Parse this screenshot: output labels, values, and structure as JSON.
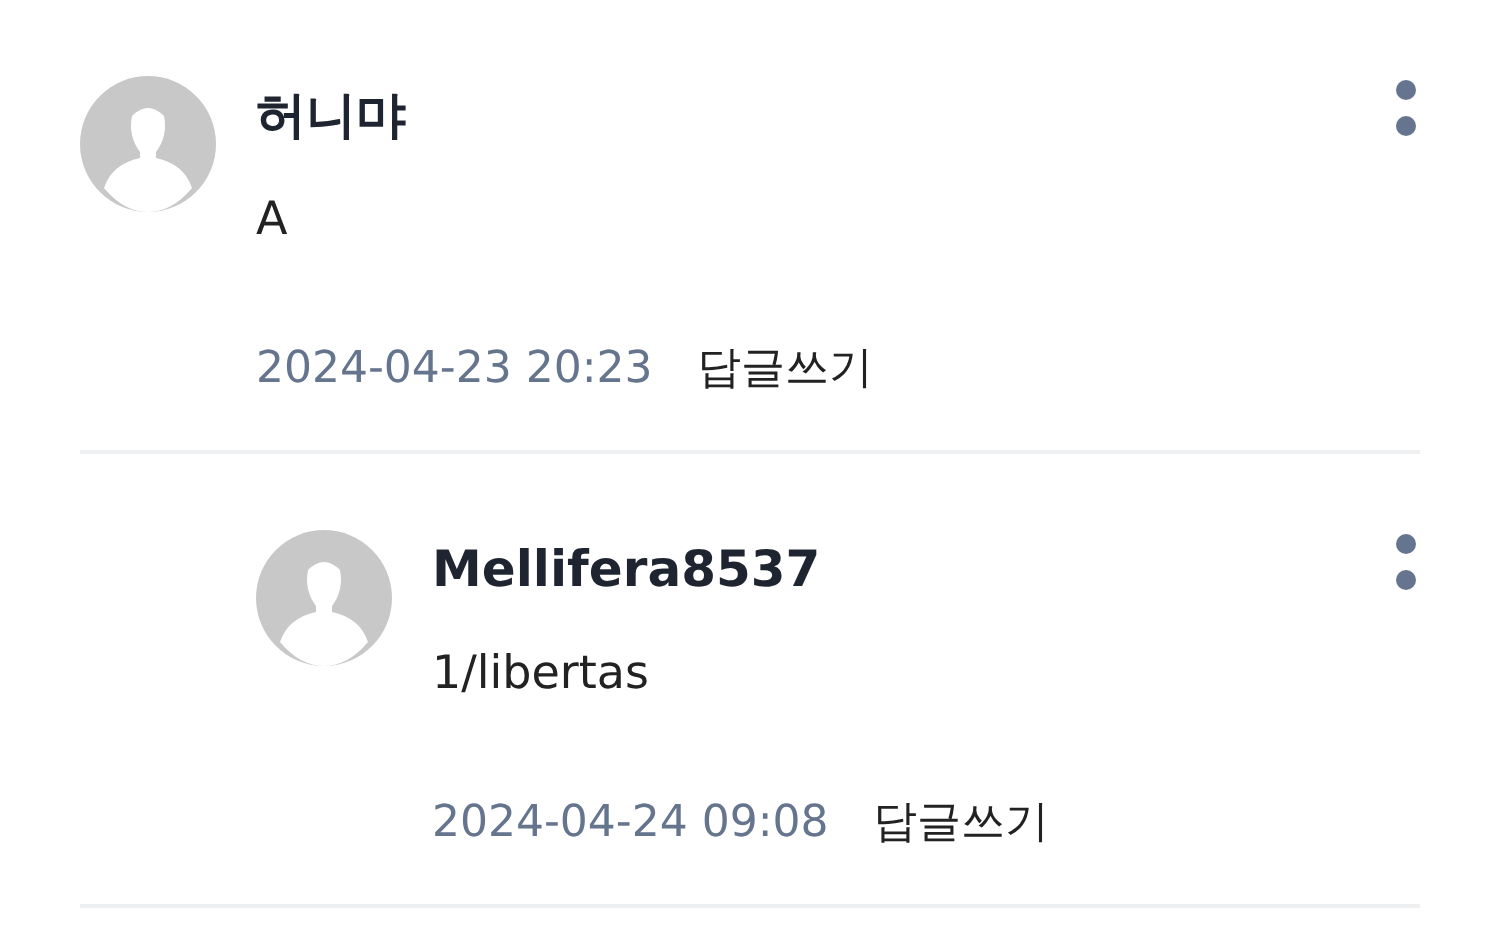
{
  "comments": [
    {
      "author": "허니먀",
      "body": "A",
      "date": "2024-04-23 20:23",
      "reply_label": "답글쓰기",
      "children": [
        {
          "author": "Mellifera8537",
          "body": "1/libertas",
          "date": "2024-04-24 09:08",
          "reply_label": "답글쓰기"
        }
      ]
    }
  ]
}
